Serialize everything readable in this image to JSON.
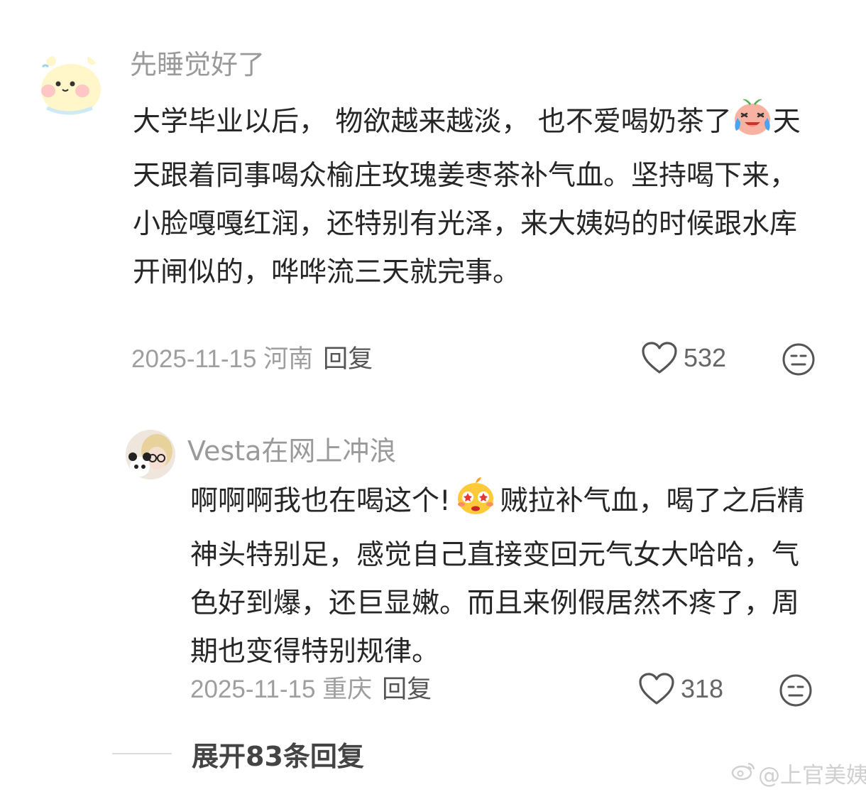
{
  "comments": [
    {
      "username": "先睡觉好了",
      "text_part1": "大学毕业以后， 物欲越来越淡， 也不爱喝奶茶了",
      "text_part2": "天天跟着同事喝众榆庄玫瑰姜枣茶补气血。坚持喝下来，小脸嘎嘎红润，还特别有光泽，来大姨妈的时候跟水库开闸似的，哗哗流三天就完事。",
      "date_location": "2025-11-15 河南",
      "reply_label": "回复",
      "likes": "532"
    },
    {
      "username": "Vesta在网上冲浪",
      "text_part1": "啊啊啊我也在喝这个!",
      "text_part2": "贼拉补气血，喝了之后精神头特别足，感觉自己直接变回元气女大哈哈，气色好到爆，还巨显嫩。而且来例假居然不疼了，周期也变得特别规律。",
      "date_location": "2025-11-15 重庆",
      "reply_label": "回复",
      "likes": "318"
    }
  ],
  "expand_replies": "展开83条回复",
  "watermark": "@上官美姨",
  "icons": {
    "like": "heart-outline-icon",
    "dislike": "meh-face-icon",
    "emoji_laugh_cry": "laughing-crying-emoji-icon",
    "emoji_starry": "starry-eyed-emoji-icon",
    "watermark_logo": "weibo-logo-icon"
  }
}
